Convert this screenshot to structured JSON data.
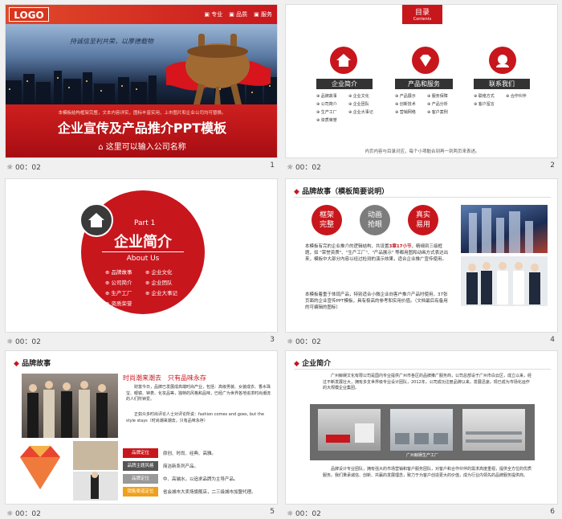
{
  "slides": [
    {
      "time": "00：02",
      "num": "1"
    },
    {
      "time": "00：02",
      "num": "2"
    },
    {
      "time": "00：02",
      "num": "3"
    },
    {
      "time": "00：02",
      "num": "4"
    },
    {
      "time": "00：02",
      "num": "5"
    },
    {
      "time": "00：02",
      "num": "6"
    }
  ],
  "s1": {
    "logo": "LOGO",
    "nav": [
      "专业",
      "品质",
      "服务"
    ],
    "slogan": "持诚信至利共荣，以厚德载物",
    "small": "本模板结构框架完整，文本内容详实，图标丰富实用，上市图片和企业公司均可替换。",
    "title": "企业宣传及产品推介PPT模板",
    "company": "这里可以输入公司名称"
  },
  "s2": {
    "tab": "目录",
    "tab_sub": "Contents",
    "cols": [
      {
        "head": "企业简介",
        "items": [
          "品牌故事",
          "企业文化",
          "公司简介",
          "企业团队",
          "生产工厂",
          "企业大事记",
          "资质荣誉"
        ]
      },
      {
        "head": "产品和服务",
        "items": [
          "产品展示",
          "服务保障",
          "创新技术",
          "产品分析",
          "营销网络",
          "客户案例"
        ]
      },
      {
        "head": "联系我们",
        "items": [
          "联络方式",
          "合作伙伴",
          "客户留言"
        ]
      }
    ],
    "footer": "内页内容与目录对应，每个小项黏合到再一到两页来表述。"
  },
  "s3": {
    "part": "Part 1",
    "title": "企业简介",
    "sub": "About Us",
    "items": [
      "品牌故事",
      "企业文化",
      "公司简介",
      "企业团队",
      "生产工厂",
      "企业大事记",
      "资质荣誉"
    ]
  },
  "s4": {
    "title": "品牌故事（模板简要说明）",
    "circles": [
      "框架\n完整",
      "动画\n抢眼",
      "真实\n易用"
    ],
    "para1_pre": "本模板有完的企业推介的逻辑结构，共设置",
    "para1_hl": "3章17小节",
    "para1_post": "，精细到三级框题，如 \"荣誉资质\"、\"生产工厂\"、\"产品展示\" 等都用图和动画方式表达出来，模板中大部分内容以经过检测的演示效果，适合企业推广宣传使用。",
    "para2": "本模板着重于体现产品，特别适合小微企业向客户推介产品时使用，37张页面的企业宣传PPT模板，具有极高的参考和实用价值。（文档最后有备用的可编辑的图标）"
  },
  "s5": {
    "title": "品牌故事",
    "tagline_a": "时尚潮来潮去",
    "tagline_b": "只有品味永存",
    "text1": "财富今日，品牌已发展成高端时尚产业，包括：高级男装、女装成衣、香水珠宝、眼镜、钟表、化妆品等，独特的风格和品味，已经广为世界各地追求时尚潮流的人们所钟爱。",
    "text2": "正如众多时尚评论人士对评论所说：fashion comes and goes, but the style stays（时尚潮来潮去，只有品味永存）",
    "rows": [
      {
        "label": "品牌定位",
        "text": "原创、时尚、经典、高雅。"
      },
      {
        "label": "品牌主题风格",
        "text": "简洁新系列产品。"
      },
      {
        "label": "品牌定位",
        "text": "中、高端水，以追求品牌为主导产品。"
      },
      {
        "label": "销售渠道定位",
        "text": "省会城市大卖场旗舰店，二三级城市加盟代理。"
      }
    ]
  },
  "s6": {
    "title": "企业简介",
    "para1": "广州鲸娱文化有限公司是国内专业提供广州市各区的品牌推广服务商，公司总部设于广州市白云区，成立以来，经过不断发展壮大，拥有多支世界级专业设计团队，2012年，公司成功注册品牌以来，发展迅速，现已成为市场化运作的大规模企业集团。",
    "caption": "广州鲸娱生产工厂",
    "para2": "品牌设计专业团队，拥有强大的市场营销和客户服务团队，对客户和合作伙伴的需求高度重视，提供全方位的优质服务。我们秉承诚信、创新、共赢的发展理念，致力于为客户创造更大的价值，成为行业内领先的品牌服务提供商。"
  }
}
